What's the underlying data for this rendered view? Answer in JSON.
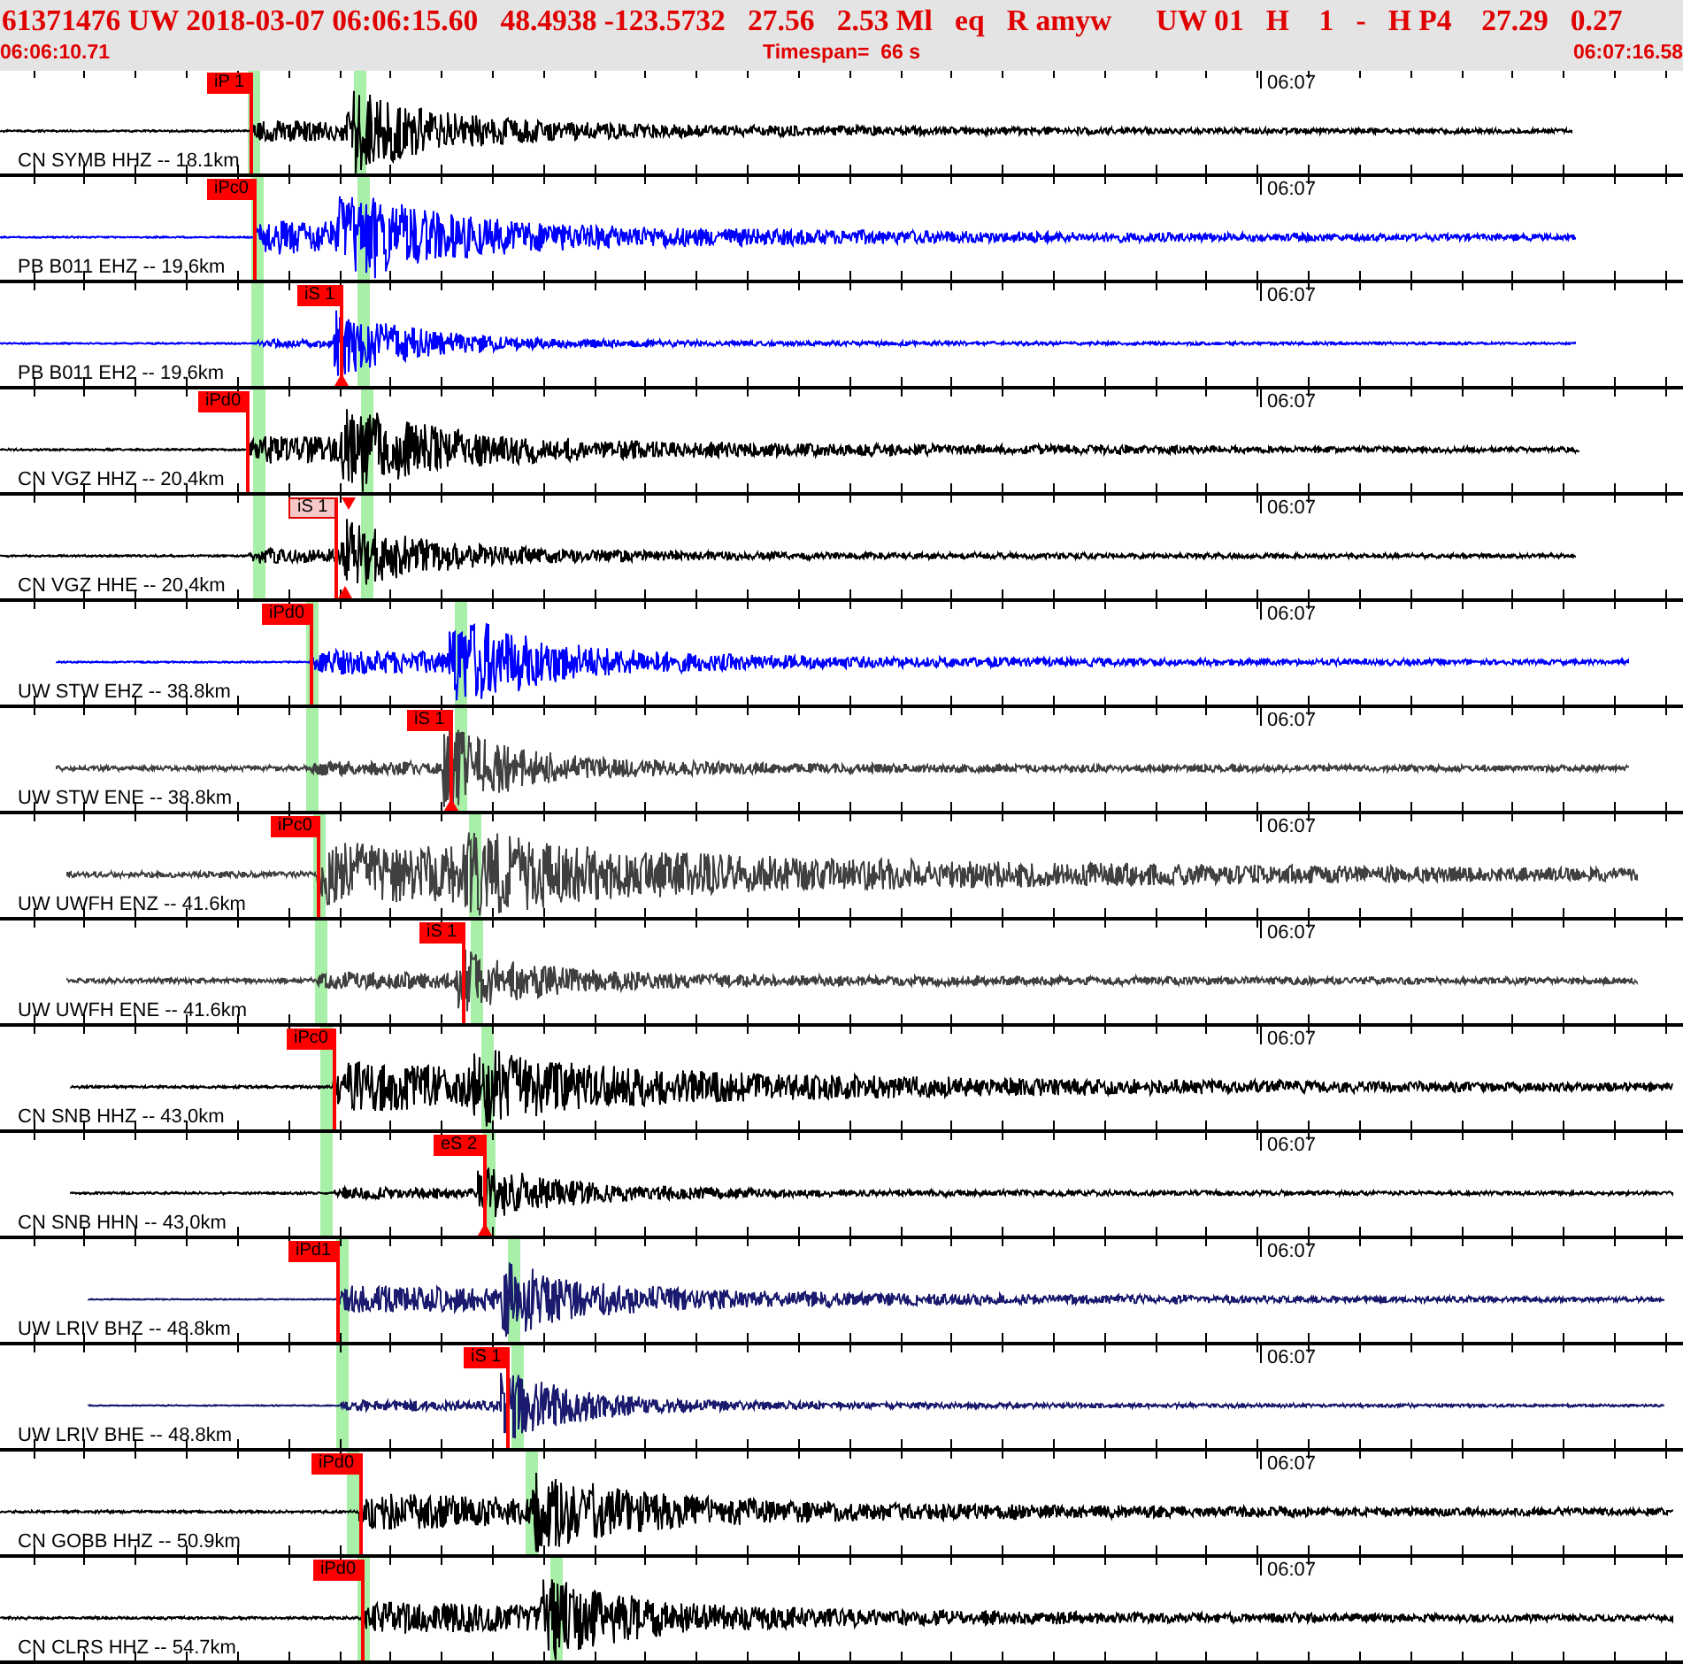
{
  "header": {
    "title": "61371476 UW 2018-03-07 06:06:15.60   48.4938 -123.5732   27.56   2.53 Ml   eq   R amyw      UW 01   H    1   -   H P4    27.29   0.27",
    "start_time": "06:06:10.71",
    "timespan": "Timespan=  66 s",
    "end_time": "06:07:16.58"
  },
  "traces": [
    {
      "label": "CN SYMB HHZ -- 18.1km",
      "color": "#000000",
      "time_mark": "06:07",
      "pick": {
        "label": "iP 1",
        "active": true
      }
    },
    {
      "label": "PB B011 EHZ -- 19.6km",
      "color": "#0000ff",
      "time_mark": "06:07",
      "pick": {
        "label": "iPc0",
        "active": true
      }
    },
    {
      "label": "PB B011 EH2 -- 19.6km",
      "color": "#0000ff",
      "time_mark": "06:07",
      "pick": {
        "label": "iS 1",
        "active": true
      }
    },
    {
      "label": "CN VGZ HHZ -- 20.4km",
      "color": "#000000",
      "time_mark": "06:07",
      "pick": {
        "label": "iPd0",
        "active": true
      }
    },
    {
      "label": "CN VGZ HHE -- 20.4km",
      "color": "#000000",
      "time_mark": "06:07",
      "pick": {
        "label": "iS 1",
        "active": false
      }
    },
    {
      "label": "UW STW EHZ -- 38.8km",
      "color": "#0000ff",
      "time_mark": "06:07",
      "pick": {
        "label": "iPd0",
        "active": true
      }
    },
    {
      "label": "UW STW ENE -- 38.8km",
      "color": "#404040",
      "time_mark": "06:07",
      "pick": {
        "label": "iS 1",
        "active": true
      }
    },
    {
      "label": "UW UWFH ENZ -- 41.6km",
      "color": "#404040",
      "time_mark": "06:07",
      "pick": {
        "label": "iPc0",
        "active": true
      }
    },
    {
      "label": "UW UWFH ENE -- 41.6km",
      "color": "#404040",
      "time_mark": "06:07",
      "pick": {
        "label": "iS 1",
        "active": true
      }
    },
    {
      "label": "CN SNB HHZ -- 43.0km",
      "color": "#000000",
      "time_mark": "06:07",
      "pick": {
        "label": "iPc0",
        "active": true
      }
    },
    {
      "label": "CN SNB HHN -- 43.0km",
      "color": "#000000",
      "time_mark": "06:07",
      "pick": {
        "label": "eS 2",
        "active": true
      }
    },
    {
      "label": "UW LRIV BHZ -- 48.8km",
      "color": "#1a1a6e",
      "time_mark": "06:07",
      "pick": {
        "label": "iPd1",
        "active": true
      }
    },
    {
      "label": "UW LRIV BHE -- 48.8km",
      "color": "#1a1a6e",
      "time_mark": "06:07",
      "pick": {
        "label": "iS 1",
        "active": true
      }
    },
    {
      "label": "CN GOBB HHZ -- 50.9km",
      "color": "#000000",
      "time_mark": "06:07",
      "pick": {
        "label": "iPd0",
        "active": true
      }
    },
    {
      "label": "CN CLRS HHZ -- 54.7km",
      "color": "#000000",
      "time_mark": "06:07",
      "pick": {
        "label": "iPd0",
        "active": true
      }
    }
  ]
}
